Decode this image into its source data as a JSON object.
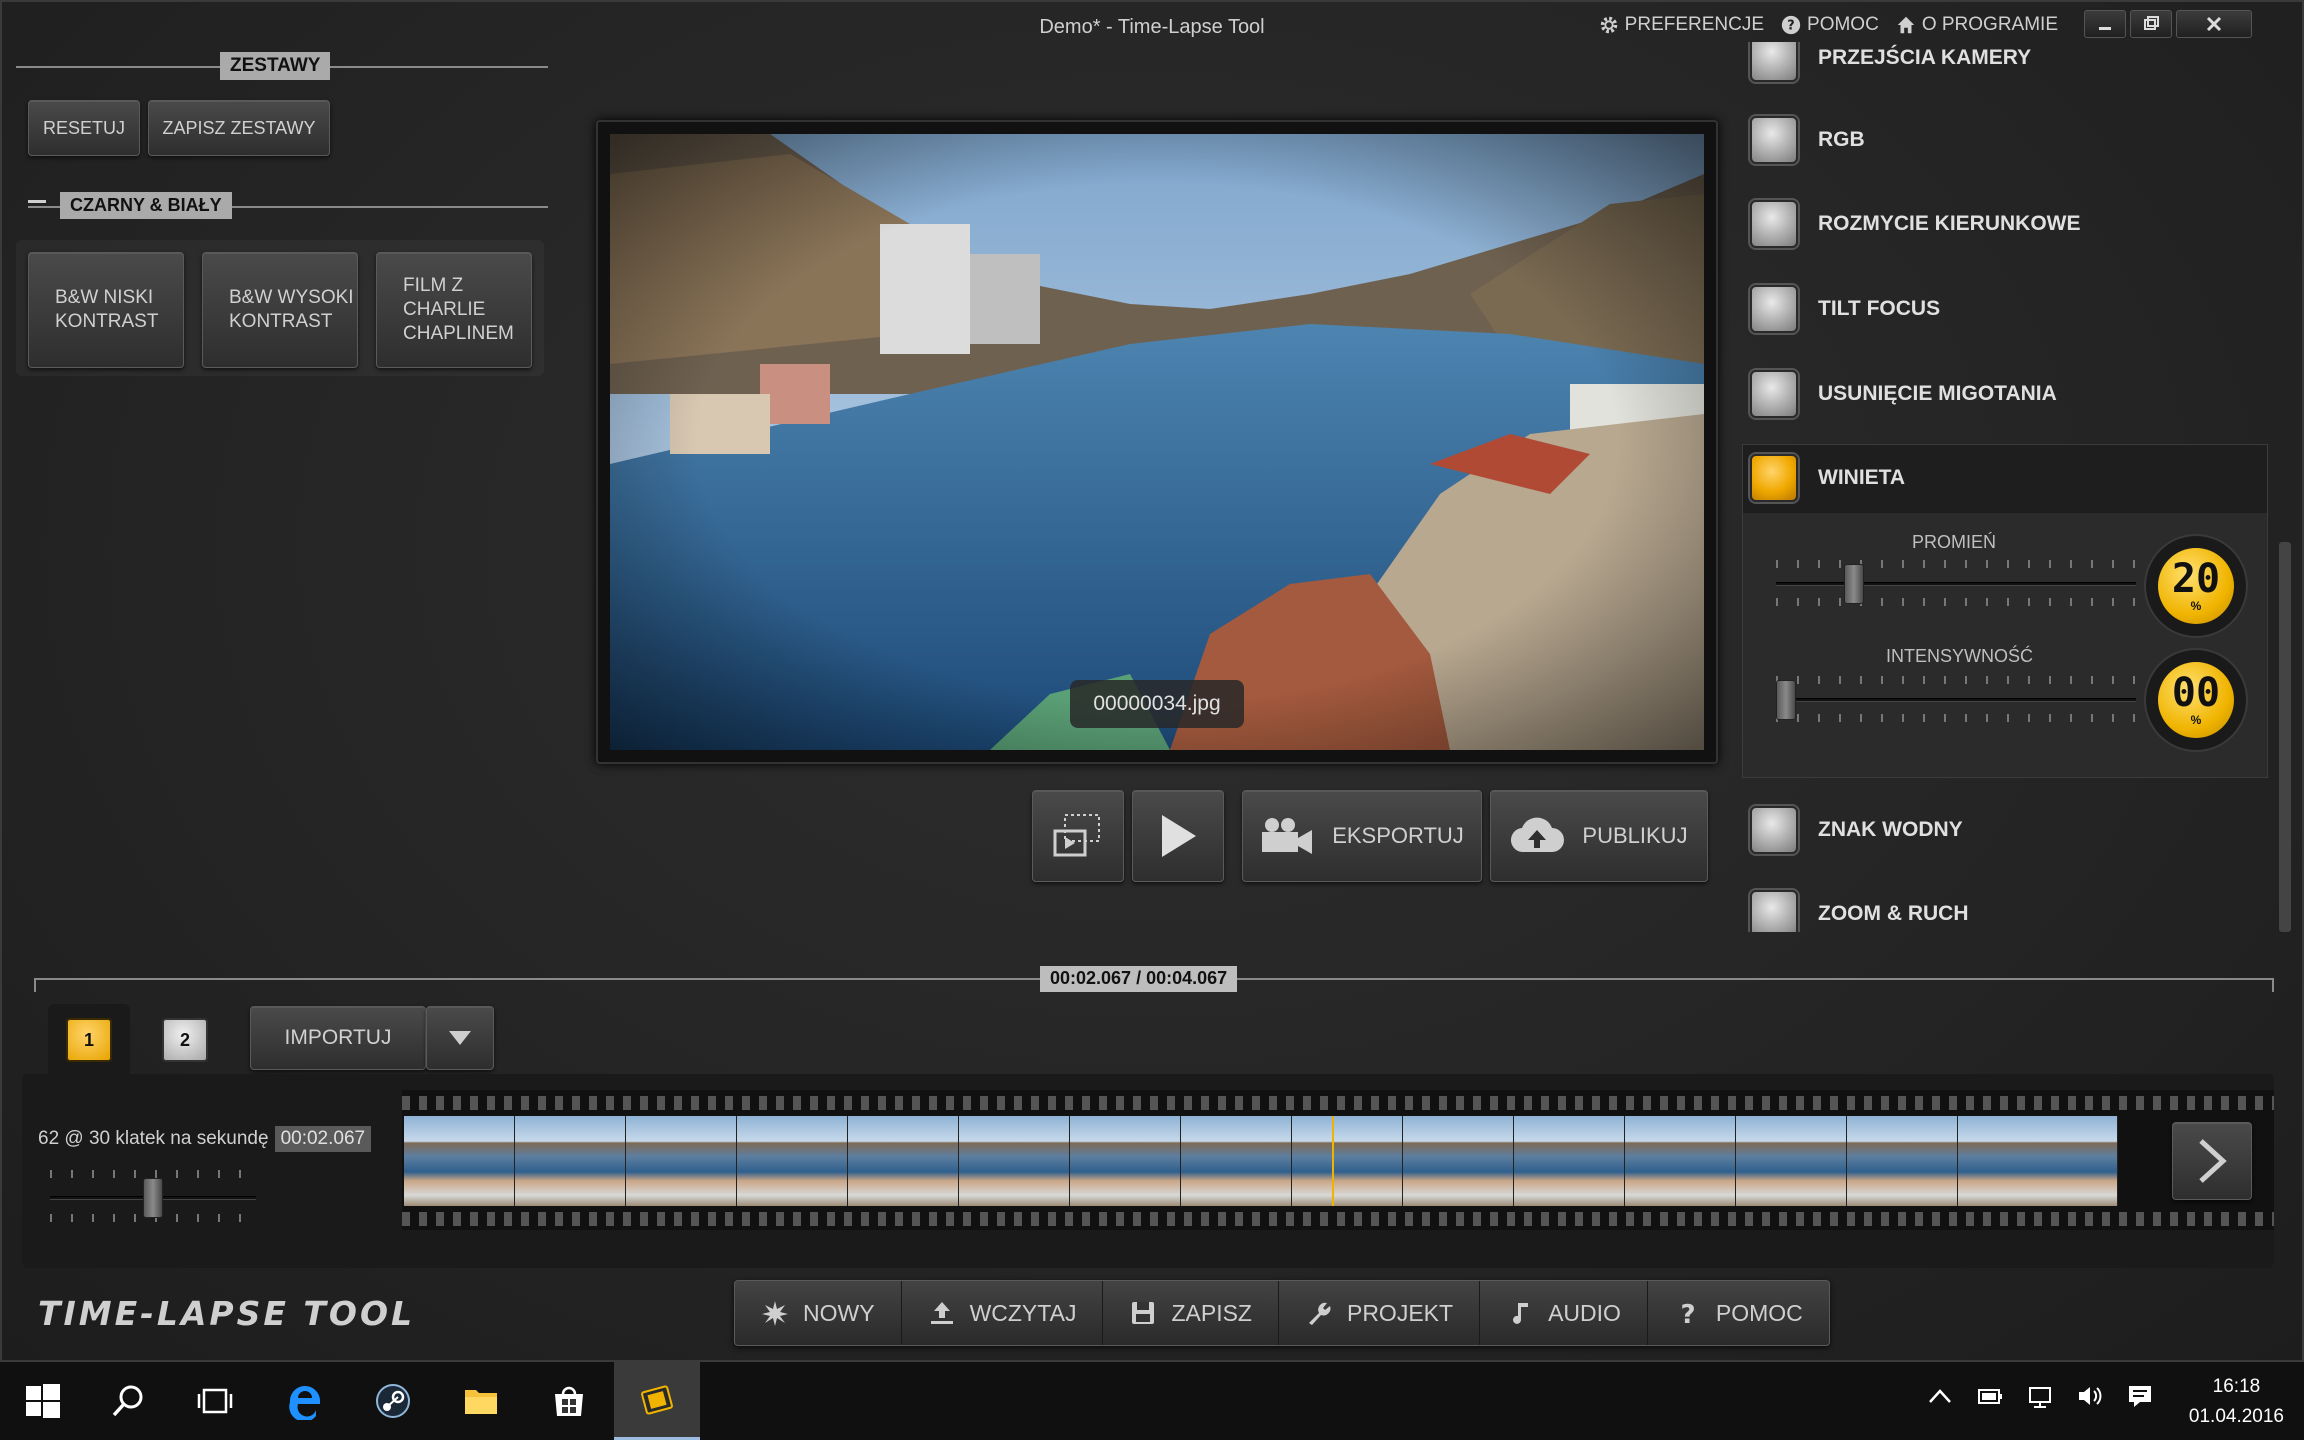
{
  "window": {
    "title": "Demo* - Time-Lapse Tool",
    "menu": [
      {
        "label": "PREFERENCJE",
        "icon": "gear-icon"
      },
      {
        "label": "POMOC",
        "icon": "help-icon"
      },
      {
        "label": "O PROGRAMIE",
        "icon": "home-icon"
      }
    ]
  },
  "presets": {
    "header": "ZESTAWY",
    "reset_label": "RESETUJ",
    "save_label": "ZAPISZ ZESTAWY",
    "group_title": "CZARNY & BIAŁY",
    "items": [
      "B&W NISKI KONTRAST",
      "B&W WYSOKI KONTRAST",
      "FILM Z CHARLIE CHAPLINEM"
    ]
  },
  "preview": {
    "filename": "00000034.jpg"
  },
  "transport": {
    "export_label": "EKSPORTUJ",
    "publish_label": "PUBLIKUJ"
  },
  "effects": {
    "items": [
      {
        "label": "PRZEJŚCIA KAMERY",
        "checked": false
      },
      {
        "label": "RGB",
        "checked": false
      },
      {
        "label": "ROZMYCIE KIERUNKOWE",
        "checked": false
      },
      {
        "label": "TILT FOCUS",
        "checked": false
      },
      {
        "label": "USUNIĘCIE MIGOTANIA",
        "checked": false
      },
      {
        "label": "WINIETA",
        "checked": true
      },
      {
        "label": "ZNAK WODNY",
        "checked": false
      },
      {
        "label": "ZOOM & RUCH",
        "checked": false
      }
    ],
    "vignette": {
      "radius_label": "PROMIEŃ",
      "radius_value": "20",
      "radius_fraction": 0.2,
      "intensity_label": "INTENSYWNOŚĆ",
      "intensity_value": "00",
      "intensity_fraction": 0.0,
      "unit": "%"
    }
  },
  "timeline": {
    "current_time": "00:02.067",
    "separator": "/",
    "total_time": "00:04.067",
    "tabs": [
      "1",
      "2"
    ],
    "active_tab": "1",
    "import_label": "IMPORTUJ",
    "frame_info": "62 @ 30 klatek na sekundę",
    "frame_time": "00:02.067",
    "speed_fraction": 0.5
  },
  "bottom": {
    "logo": "TIME-LAPSE TOOL",
    "items": [
      {
        "label": "NOWY",
        "icon": "new-icon"
      },
      {
        "label": "WCZYTAJ",
        "icon": "upload-icon"
      },
      {
        "label": "ZAPISZ",
        "icon": "save-icon"
      },
      {
        "label": "PROJEKT",
        "icon": "wrench-icon"
      },
      {
        "label": "AUDIO",
        "icon": "music-note-icon"
      },
      {
        "label": "POMOC",
        "icon": "question-icon"
      }
    ]
  },
  "taskbar": {
    "time": "16:18",
    "date": "01.04.2016"
  },
  "colors": {
    "accent": "#f0b400",
    "background": "#252525"
  }
}
